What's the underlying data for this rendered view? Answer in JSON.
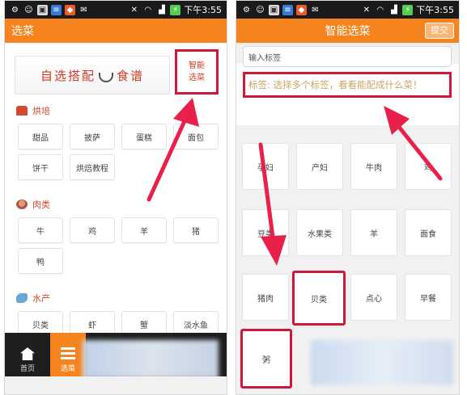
{
  "status_bar": {
    "time": "下午3:55"
  },
  "left_screen": {
    "title": "选菜",
    "banner_text_1": "自选搭配",
    "banner_text_2": "食谱",
    "smart_pick_line1": "智能",
    "smart_pick_line2": "选菜",
    "sections": [
      {
        "label": "烘培",
        "icon": "oven-icon"
      },
      {
        "label": "肉类",
        "icon": "meat-icon"
      },
      {
        "label": "水产",
        "icon": "fish-icon"
      }
    ],
    "tags": {
      "baking": [
        "甜品",
        "披萨",
        "蛋糕",
        "面包",
        "饼干",
        "烘焙教程"
      ],
      "meat": [
        "牛",
        "鸡",
        "羊",
        "猪",
        "鸭"
      ],
      "seafood": [
        "贝类",
        "虾",
        "蟹",
        "淡水鱼"
      ]
    },
    "bottom_nav": [
      "首页",
      "选菜"
    ]
  },
  "right_screen": {
    "title": "智能选菜",
    "submit_label": "提交",
    "search_placeholder": "输入标签",
    "hint": "标签: 选择多个标签，看看能配成什么菜！",
    "grid": [
      "孕妇",
      "产妇",
      "牛肉",
      "鸡",
      "豆类",
      "水果类",
      "羊",
      "面食",
      "猪肉",
      "贝类",
      "点心",
      "早餐",
      "粥"
    ]
  },
  "colors": {
    "accent": "#f5841f",
    "highlight": "#d1173a"
  }
}
